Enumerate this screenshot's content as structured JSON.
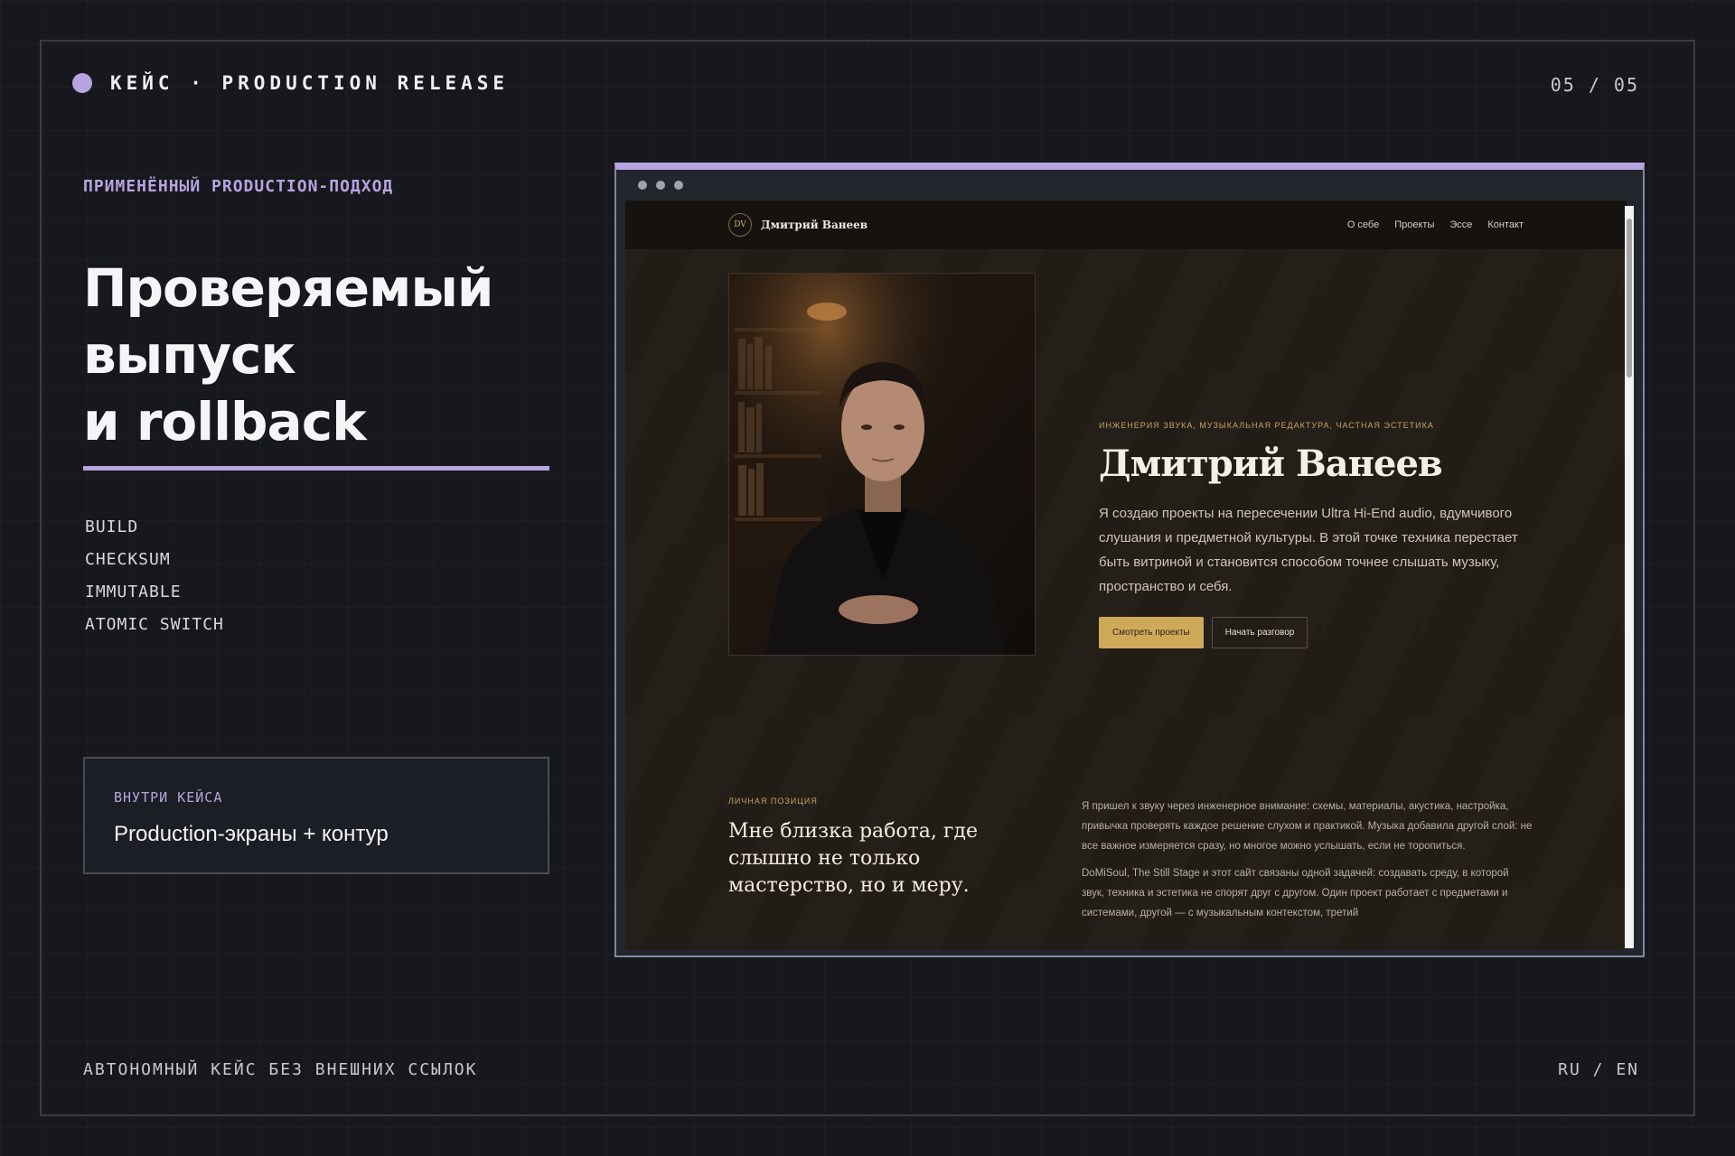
{
  "header": {
    "case_title": "КЕЙС · PRODUCTION RELEASE",
    "page_counter": "05 / 05"
  },
  "left": {
    "eyebrow": "ПРИМЕНЁННЫЙ PRODUCTION-ПОДХОД",
    "headline_lines": [
      "Проверяемый",
      "выпуск",
      "и rollback"
    ],
    "tags": [
      "BUILD",
      "CHECKSUM",
      "IMMUTABLE",
      "ATOMIC SWITCH"
    ],
    "inside_card": {
      "label": "ВНУТРИ КЕЙСА",
      "text": "Production-экраны + контур"
    }
  },
  "footer": {
    "left": "АВТОНОМНЫЙ КЕЙС БЕЗ ВНЕШНИХ ССЫЛОК",
    "lang": "RU / EN"
  },
  "site": {
    "brand_mono": "DV",
    "brand_name": "Дмитрий Ванеев",
    "nav": [
      "О себе",
      "Проекты",
      "Эссе",
      "Контакт"
    ],
    "hero": {
      "eyebrow": "ИНЖЕНЕРИЯ ЗВУКА, МУЗЫКАЛЬНАЯ РЕДАКТУРА, ЧАСТНАЯ ЭСТЕТИКА",
      "name": "Дмитрий Ванеев",
      "text": "Я создаю проекты на пересечении Ultra Hi-End audio, вдумчивого слушания и предметной культуры. В этой точке техника перестает быть витриной и становится способом точнее слышать музыку, пространство и себя.",
      "primary_button": "Смотреть проекты",
      "secondary_button": "Начать разговор"
    },
    "position": {
      "label": "ЛИЧНАЯ ПОЗИЦИЯ",
      "quote": "Мне близка работа, где слышно не только мастерство, но и меру."
    },
    "story": [
      "Я пришел к звуку через инженерное внимание: схемы, материалы, акустика, настройка, привычка проверять каждое решение слухом и практикой. Музыка добавила другой слой: не все важное измеряется сразу, но многое можно услышать, если не торопиться.",
      "DoMiSoul, The Still Stage и этот сайт связаны одной задачей: создавать среду, в которой звук, техника и эстетика не спорят друг с другом. Один проект работает с предметами и системами, другой — с музыкальным контекстом, третий"
    ]
  },
  "colors": {
    "accent": "#b7a3e0",
    "gold": "#cfa95a",
    "background": "#17181d"
  }
}
